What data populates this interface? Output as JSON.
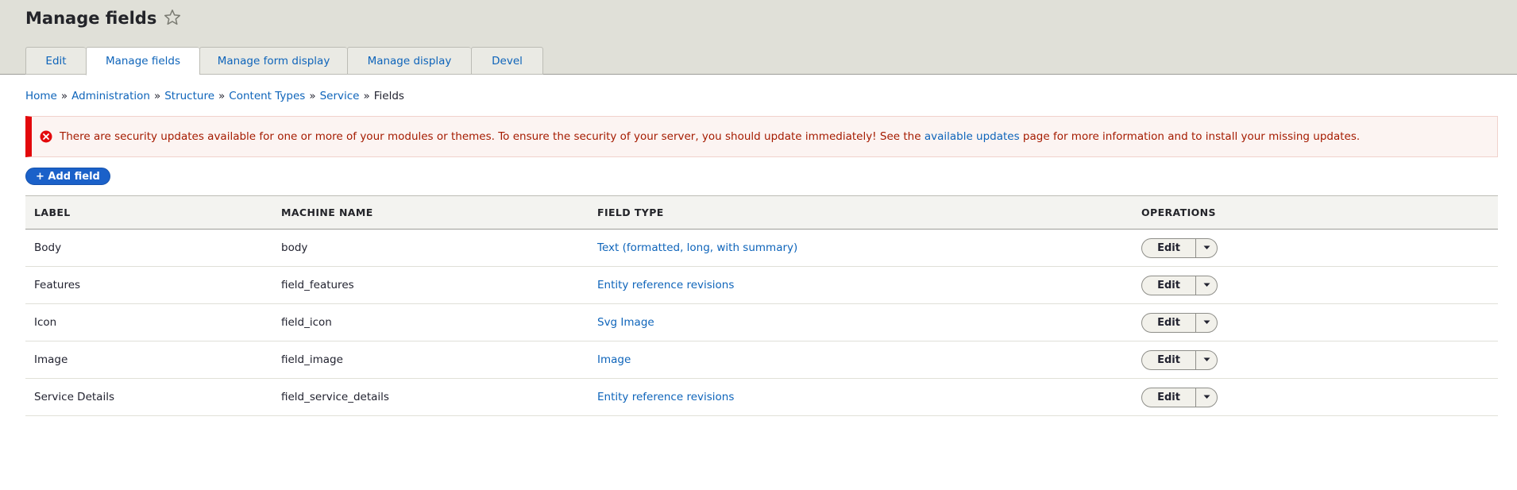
{
  "page": {
    "title": "Manage fields",
    "star_icon": "star-outline-icon"
  },
  "tabs": [
    {
      "label": "Edit",
      "active": false
    },
    {
      "label": "Manage fields",
      "active": true
    },
    {
      "label": "Manage form display",
      "active": false
    },
    {
      "label": "Manage display",
      "active": false
    },
    {
      "label": "Devel",
      "active": false
    }
  ],
  "breadcrumb": {
    "items": [
      "Home",
      "Administration",
      "Structure",
      "Content Types",
      "Service"
    ],
    "current": "Fields",
    "separator": "»"
  },
  "alert": {
    "icon": "error-icon",
    "text_before": "There are security updates available for one or more of your modules or themes. To ensure the security of your server, you should update immediately! See the ",
    "link": "available updates",
    "text_after": " page for more information and to install your missing updates."
  },
  "actions": {
    "add_field": "+ Add field"
  },
  "table": {
    "headers": {
      "label": "LABEL",
      "machine_name": "MACHINE NAME",
      "field_type": "FIELD TYPE",
      "operations": "OPERATIONS"
    },
    "rows": [
      {
        "label": "Body",
        "machine_name": "body",
        "field_type": "Text (formatted, long, with summary)",
        "op": "Edit"
      },
      {
        "label": "Features",
        "machine_name": "field_features",
        "field_type": "Entity reference revisions",
        "op": "Edit"
      },
      {
        "label": "Icon",
        "machine_name": "field_icon",
        "field_type": "Svg Image",
        "op": "Edit"
      },
      {
        "label": "Image",
        "machine_name": "field_image",
        "field_type": "Image",
        "op": "Edit"
      },
      {
        "label": "Service Details",
        "machine_name": "field_service_details",
        "field_type": "Entity reference revisions",
        "op": "Edit"
      }
    ]
  },
  "colors": {
    "link": "#0e64ba",
    "primary_button": "#1b61c9",
    "error_border": "#e3080b",
    "error_text": "#a51b00",
    "header_bg": "#e0e0d8"
  }
}
